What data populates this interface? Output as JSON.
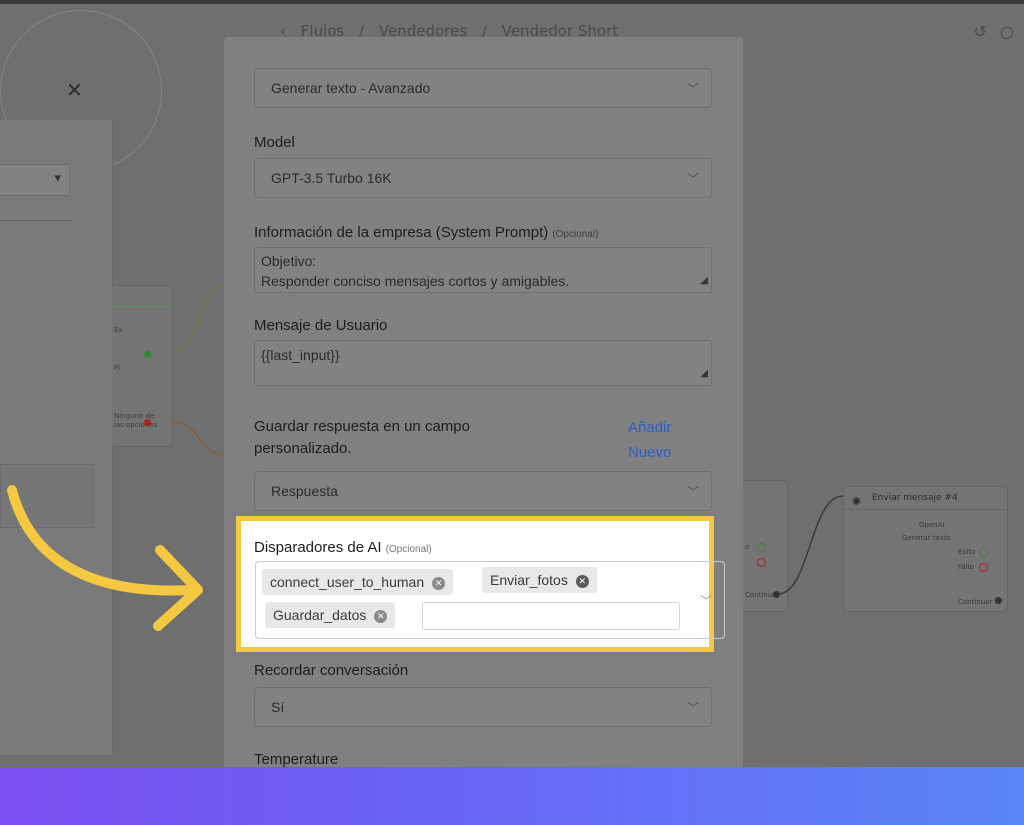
{
  "breadcrumb": [
    "Flujos",
    "Vendedores",
    "Vendedor Short"
  ],
  "background": {
    "node_right_title": "Enviar mensaje #4",
    "node_right_provider": "OpenAI",
    "node_right_action": "Generar texto",
    "node_right_success": "Exito",
    "node_right_fail": "Fallo",
    "node_right_continue": "Continuar",
    "node_mid_continue": "Continuar",
    "node_left_line1": "Éx",
    "node_left_line2": "Fl",
    "node_left_line3": "Ninguna de",
    "node_left_line4": "las opciones"
  },
  "form": {
    "action_select": "Generar texto - Avanzado",
    "model_label": "Model",
    "model_value": "GPT-3.5 Turbo 16K",
    "system_prompt_label": "Información de la empresa (System Prompt)",
    "optional_tag": "(Opcional)",
    "system_prompt_line1": "Objetivo:",
    "system_prompt_line2": "Responder conciso mensajes cortos y amigables.",
    "user_message_label": "Mensaje de Usuario",
    "user_message_value": "{{last_input}}",
    "save_response_label_1": "Guardar respuesta en un campo",
    "save_response_label_2": "personalizado.",
    "add_new_1": "Añadir",
    "add_new_2": "Nuevo",
    "save_response_value": "Respuesta",
    "ai_triggers_label": "Disparadores de AI",
    "ai_triggers": [
      "connect_user_to_human",
      "Enviar_fotos",
      "Guardar_datos"
    ],
    "remember_label": "Recordar conversación",
    "remember_value": "Sí",
    "temperature_label": "Temperature"
  },
  "colors": {
    "highlight": "#f5c842",
    "link": "#2a5fc8",
    "band_start": "#7b4ff0",
    "band_end": "#5a86f8"
  }
}
